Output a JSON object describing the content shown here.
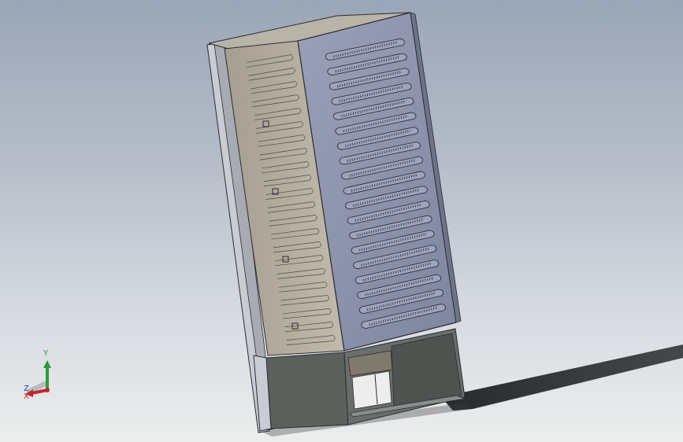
{
  "viewport": {
    "background_top": "#9aa6b7",
    "background_bottom": "#eceded"
  },
  "model": {
    "rear_panel_color": "#8e95ad",
    "inner_panel_color": "#b9b1a2",
    "base_color": "#5f6360",
    "outline_color": "#2a2c33"
  },
  "triad": {
    "x_label": "X",
    "y_label": "Y",
    "z_label": "Z",
    "x_color": "#c0282b",
    "y_color": "#2e9a3c",
    "z_color": "#2b3fc4"
  }
}
